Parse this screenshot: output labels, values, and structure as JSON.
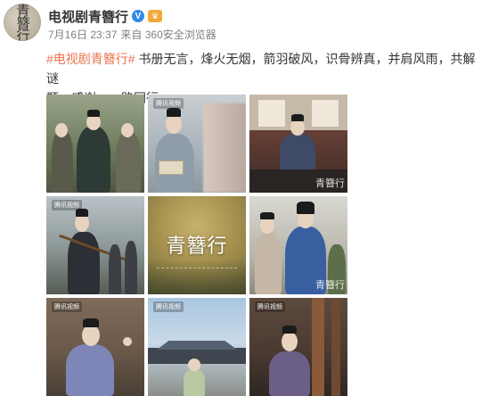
{
  "account": {
    "name": "电视剧青簪行",
    "avatar_text": "青簪行",
    "verified_icon": "v-verified-icon",
    "member_icon": "crown-member-icon"
  },
  "post": {
    "date": "7月16日 23:37",
    "source": "来自 360安全浏览器",
    "hashtag": "#电视剧青簪行#",
    "text_line1": " 书册无言，烽火无烟，箭羽破风，识骨辨真，并肩风雨，共解谜",
    "text_line2": "题。感谢，一路同行。"
  },
  "images": {
    "poster_title": "青簪行",
    "watermark": "青簪行",
    "tencent_logo": "腾讯视频"
  },
  "colors": {
    "hashtag": "#eb7350",
    "name": "#333333",
    "meta": "#808080",
    "verified": "#2f8ae5"
  }
}
